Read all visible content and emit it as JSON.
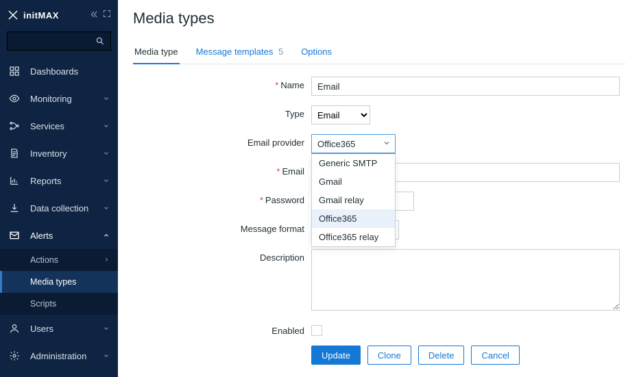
{
  "brand": "initMAX",
  "search": {
    "placeholder": ""
  },
  "sidebar": {
    "items": [
      {
        "label": "Dashboards",
        "icon": "dashboard",
        "chev": false
      },
      {
        "label": "Monitoring",
        "icon": "eye",
        "chev": true
      },
      {
        "label": "Services",
        "icon": "services",
        "chev": true
      },
      {
        "label": "Inventory",
        "icon": "doc",
        "chev": true
      },
      {
        "label": "Reports",
        "icon": "chart",
        "chev": true
      },
      {
        "label": "Data collection",
        "icon": "download",
        "chev": true
      },
      {
        "label": "Alerts",
        "icon": "mail",
        "chev": true,
        "expanded": true,
        "children": [
          {
            "label": "Actions",
            "chev": true
          },
          {
            "label": "Media types",
            "active": true
          },
          {
            "label": "Scripts"
          }
        ]
      },
      {
        "label": "Users",
        "icon": "user",
        "chev": true
      },
      {
        "label": "Administration",
        "icon": "gear",
        "chev": true
      }
    ]
  },
  "page": {
    "title": "Media types"
  },
  "tabs": [
    {
      "label": "Media type",
      "active": true
    },
    {
      "label": "Message templates",
      "count": "5"
    },
    {
      "label": "Options"
    }
  ],
  "form": {
    "name": {
      "label": "Name",
      "value": "Email",
      "required": true
    },
    "type": {
      "label": "Type",
      "value": "Email"
    },
    "provider": {
      "label": "Email provider",
      "value": "Office365",
      "options": [
        "Generic SMTP",
        "Gmail",
        "Gmail relay",
        "Office365",
        "Office365 relay"
      ],
      "selected": "Office365"
    },
    "email": {
      "label": "Email",
      "value": "",
      "required": true
    },
    "password": {
      "label": "Password",
      "value": "",
      "required": true
    },
    "message_format": {
      "label": "Message format"
    },
    "description": {
      "label": "Description",
      "value": ""
    },
    "enabled": {
      "label": "Enabled",
      "checked": false
    }
  },
  "buttons": {
    "update": "Update",
    "clone": "Clone",
    "delete": "Delete",
    "cancel": "Cancel"
  }
}
